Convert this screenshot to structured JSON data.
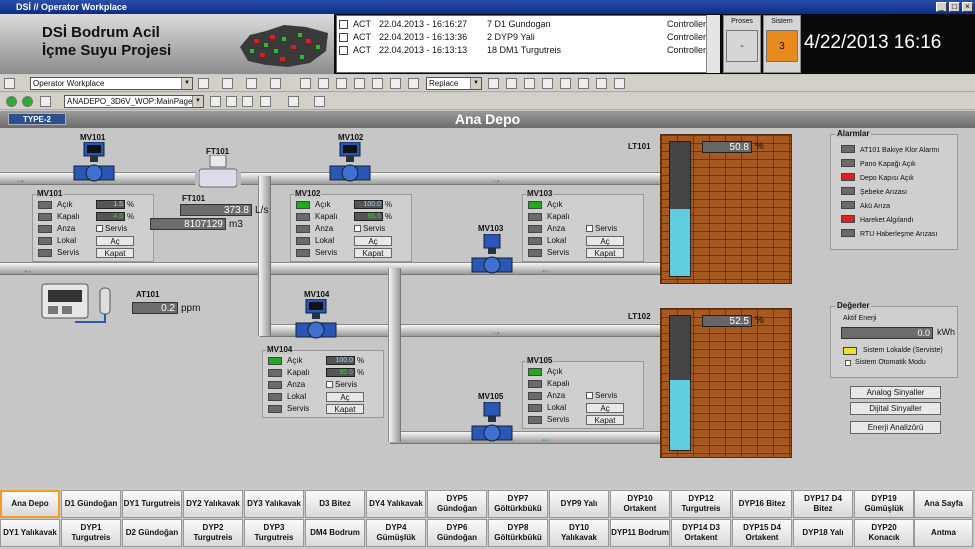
{
  "window": {
    "title": "DSİ // Operator Workplace",
    "min": "_",
    "max": "□",
    "close": "×"
  },
  "header": {
    "line1": "DSİ Bodrum Acil",
    "line2": "İçme Suyu Projesi",
    "proses_label": "Proses",
    "proses_value": "-",
    "sistem_label": "Sistem",
    "sistem_value": "3",
    "clock": "4/22/2013 16:16"
  },
  "alarms": [
    {
      "state": "ACT",
      "time": "22.04.2013 - 16:16:27",
      "msg": "7 D1 Gundogan",
      "src": "Controller_1"
    },
    {
      "state": "ACT",
      "time": "22.04.2013 - 16:13:36",
      "msg": "2 DYP9 Yali",
      "src": "Controller_1"
    },
    {
      "state": "ACT",
      "time": "22.04.2013 - 16:13:13",
      "msg": "18 DM1 Turgutreis",
      "src": "Controller_1"
    }
  ],
  "toolbar": {
    "workplace": "Operator Workplace",
    "replace": "Replace",
    "page": "ANADEPO_3D6V_WOP:MainPage"
  },
  "page": {
    "type": "TYPE-2",
    "title": "Ana Depo"
  },
  "labels": {
    "acik": "Açık",
    "kapali": "Kapalı",
    "anza": "Anza",
    "lokal": "Lokal",
    "servis": "Servis",
    "ac": "Aç",
    "kapat": "Kapat",
    "pct": "%"
  },
  "mv101": {
    "name": "MV101",
    "v1": "1.5",
    "v2": "4.5"
  },
  "mv102": {
    "name": "MV102",
    "v1": "100.0",
    "v2": "95.5"
  },
  "mv103": {
    "name": "MV103"
  },
  "mv104": {
    "name": "MV104",
    "v1": "100.0",
    "v2": "95.5"
  },
  "mv105": {
    "name": "MV105"
  },
  "ft101": {
    "name": "FT101",
    "flow": "373.8",
    "flow_unit": "L/s",
    "total": "8107129",
    "total_unit": "m3"
  },
  "at101": {
    "name": "AT101",
    "value": "0.2",
    "unit": "ppm"
  },
  "lt101": {
    "name": "LT101",
    "value": "50.8",
    "unit": "%",
    "level": 0.5
  },
  "lt102": {
    "name": "LT102",
    "value": "52.5",
    "unit": "%",
    "level": 0.52
  },
  "alarmlar": {
    "title": "Alarmlar",
    "items": [
      {
        "label": "AT101 Bakiye Klor Alarmı",
        "red": false
      },
      {
        "label": "Pano Kapağı Açık",
        "red": false
      },
      {
        "label": "Depo Kapısı Açık",
        "red": true
      },
      {
        "label": "Şebeke Arızası",
        "red": false
      },
      {
        "label": "Akü Arıza",
        "red": false
      },
      {
        "label": "Hareket Algılandı",
        "red": true
      },
      {
        "label": "RTU Haberleşme Arızası",
        "red": false
      }
    ]
  },
  "degerler": {
    "title": "Değerler",
    "energy_label": "Aktif Enerji",
    "energy_value": "0.0",
    "energy_unit": "kWh",
    "lokal": "Sistem Lokalde (Serviste)",
    "otomatik": "Sistem Otomatik Modu"
  },
  "side_buttons": [
    "Analog Sinyaller",
    "Dijital Sinyaller",
    "Enerji Analizörü"
  ],
  "nav_row1": [
    "Ana Depo",
    "D1 Gündoğan",
    "DY1 Turgutreis",
    "DY2 Yalıkavak",
    "DY3 Yalıkavak",
    "D3 Bitez",
    "DY4 Yalıkavak",
    "DYP5 Gündoğan",
    "DYP7 Göltürkbükü",
    "DYP9 Yalı",
    "DYP10 Ortakent",
    "DYP12 Turgutreis",
    "DYP16 Bitez",
    "DYP17 D4 Bitez",
    "DYP19 Gümüşlük"
  ],
  "nav_row2": [
    "DY1 Yalıkavak",
    "DYP1 Turgutreis",
    "D2 Gündoğan",
    "DYP2 Turgutreis",
    "DYP3 Turgutreis",
    "DM4 Bodrum",
    "DYP4 Gümüşlük",
    "DYP6 Gündoğan",
    "DYP8 Göltürkbükü",
    "DY10 Yalıkavak",
    "DYP11 Bodrum",
    "DYP14 D3 Ortakent",
    "DYP15 D4 Ortakent",
    "DYP18 Yalı",
    "DYP20 Konacık"
  ],
  "nav_right": [
    "Ana Sayfa",
    "Antma"
  ],
  "colors": {
    "accent": "#f59a23",
    "valve_blue": "#2b56b6",
    "tank_fill": "#5ecde0",
    "alarm_red": "#e02020",
    "pipe_arrow": "#2eaa2e"
  }
}
